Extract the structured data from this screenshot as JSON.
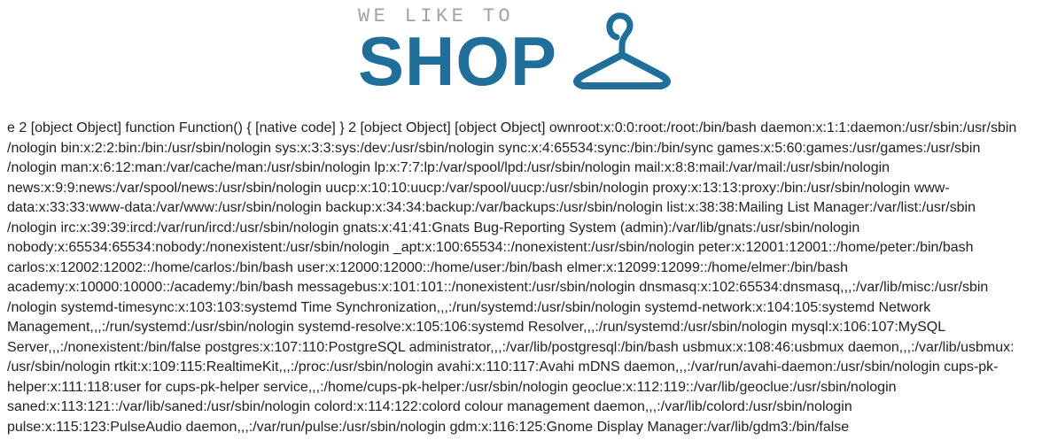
{
  "logo": {
    "tagline": "WE LIKE TO",
    "word": "SHOP",
    "icon": "hanger-icon",
    "colors": {
      "tagline": "#a3a3a3",
      "word": "#1f6f9a"
    }
  },
  "output": {
    "text": "e 2 [object Object] function Function() { [native code] } 2 [object Object] [object Object] ownroot:x:0:0:root:/root:/bin/bash daemon:x:1:1:daemon:/usr/sbin:/usr/sbin\n/nologin bin:x:2:2:bin:/bin:/usr/sbin/nologin sys:x:3:3:sys:/dev:/usr/sbin/nologin sync:x:4:65534:sync:/bin:/bin/sync games:x:5:60:games:/usr/games:/usr/sbin\n/nologin man:x:6:12:man:/var/cache/man:/usr/sbin/nologin lp:x:7:7:lp:/var/spool/lpd:/usr/sbin/nologin mail:x:8:8:mail:/var/mail:/usr/sbin/nologin\nnews:x:9:9:news:/var/spool/news:/usr/sbin/nologin uucp:x:10:10:uucp:/var/spool/uucp:/usr/sbin/nologin proxy:x:13:13:proxy:/bin:/usr/sbin/nologin www-\ndata:x:33:33:www-data:/var/www:/usr/sbin/nologin backup:x:34:34:backup:/var/backups:/usr/sbin/nologin list:x:38:38:Mailing List Manager:/var/list:/usr/sbin\n/nologin irc:x:39:39:ircd:/var/run/ircd:/usr/sbin/nologin gnats:x:41:41:Gnats Bug-Reporting System (admin):/var/lib/gnats:/usr/sbin/nologin\nnobody:x:65534:65534:nobody:/nonexistent:/usr/sbin/nologin _apt:x:100:65534::/nonexistent:/usr/sbin/nologin peter:x:12001:12001::/home/peter:/bin/bash\ncarlos:x:12002:12002::/home/carlos:/bin/bash user:x:12000:12000::/home/user:/bin/bash elmer:x:12099:12099::/home/elmer:/bin/bash\nacademy:x:10000:10000::/academy:/bin/bash messagebus:x:101:101::/nonexistent:/usr/sbin/nologin dnsmasq:x:102:65534:dnsmasq,,,:/var/lib/misc:/usr/sbin\n/nologin systemd-timesync:x:103:103:systemd Time Synchronization,,,:/run/systemd:/usr/sbin/nologin systemd-network:x:104:105:systemd Network\nManagement,,,:/run/systemd:/usr/sbin/nologin systemd-resolve:x:105:106:systemd Resolver,,,:/run/systemd:/usr/sbin/nologin mysql:x:106:107:MySQL\nServer,,,:/nonexistent:/bin/false postgres:x:107:110:PostgreSQL administrator,,,:/var/lib/postgresql:/bin/bash usbmux:x:108:46:usbmux daemon,,,:/var/lib/usbmux:\n/usr/sbin/nologin rtkit:x:109:115:RealtimeKit,,,:/proc:/usr/sbin/nologin avahi:x:110:117:Avahi mDNS daemon,,,:/var/run/avahi-daemon:/usr/sbin/nologin cups-pk-\nhelper:x:111:118:user for cups-pk-helper service,,,:/home/cups-pk-helper:/usr/sbin/nologin geoclue:x:112:119::/var/lib/geoclue:/usr/sbin/nologin\nsaned:x:113:121::/var/lib/saned:/usr/sbin/nologin colord:x:114:122:colord colour management daemon,,,:/var/lib/colord:/usr/sbin/nologin\npulse:x:115:123:PulseAudio daemon,,,:/var/run/pulse:/usr/sbin/nologin gdm:x:116:125:Gnome Display Manager:/var/lib/gdm3:/bin/false"
  }
}
